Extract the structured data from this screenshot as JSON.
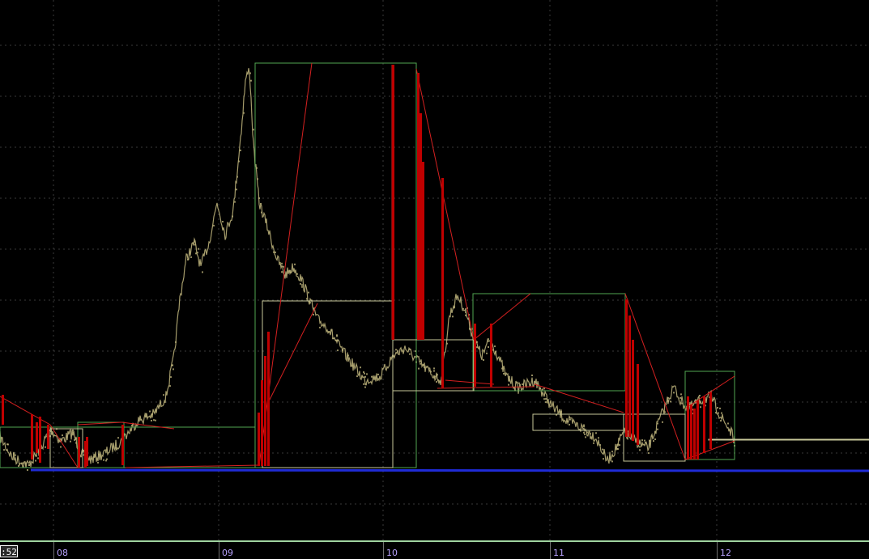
{
  "chart": {
    "time_label": ":52",
    "colors": {
      "background": "#000000",
      "grid": "#3a3a3a",
      "price": "#b7ad77",
      "green_box": "#52a652",
      "khaki_box": "#c8c89a",
      "red_line": "#d42020",
      "red_bar": "#c00000",
      "blue_line": "#1f2bd6",
      "tick_label": "#b9a3ff",
      "bottom_line": "#9fd39f"
    },
    "x_ticks": [
      {
        "label": "08"
      },
      {
        "label": "09"
      },
      {
        "label": "10"
      },
      {
        "label": "11"
      },
      {
        "label": "12"
      }
    ]
  }
}
